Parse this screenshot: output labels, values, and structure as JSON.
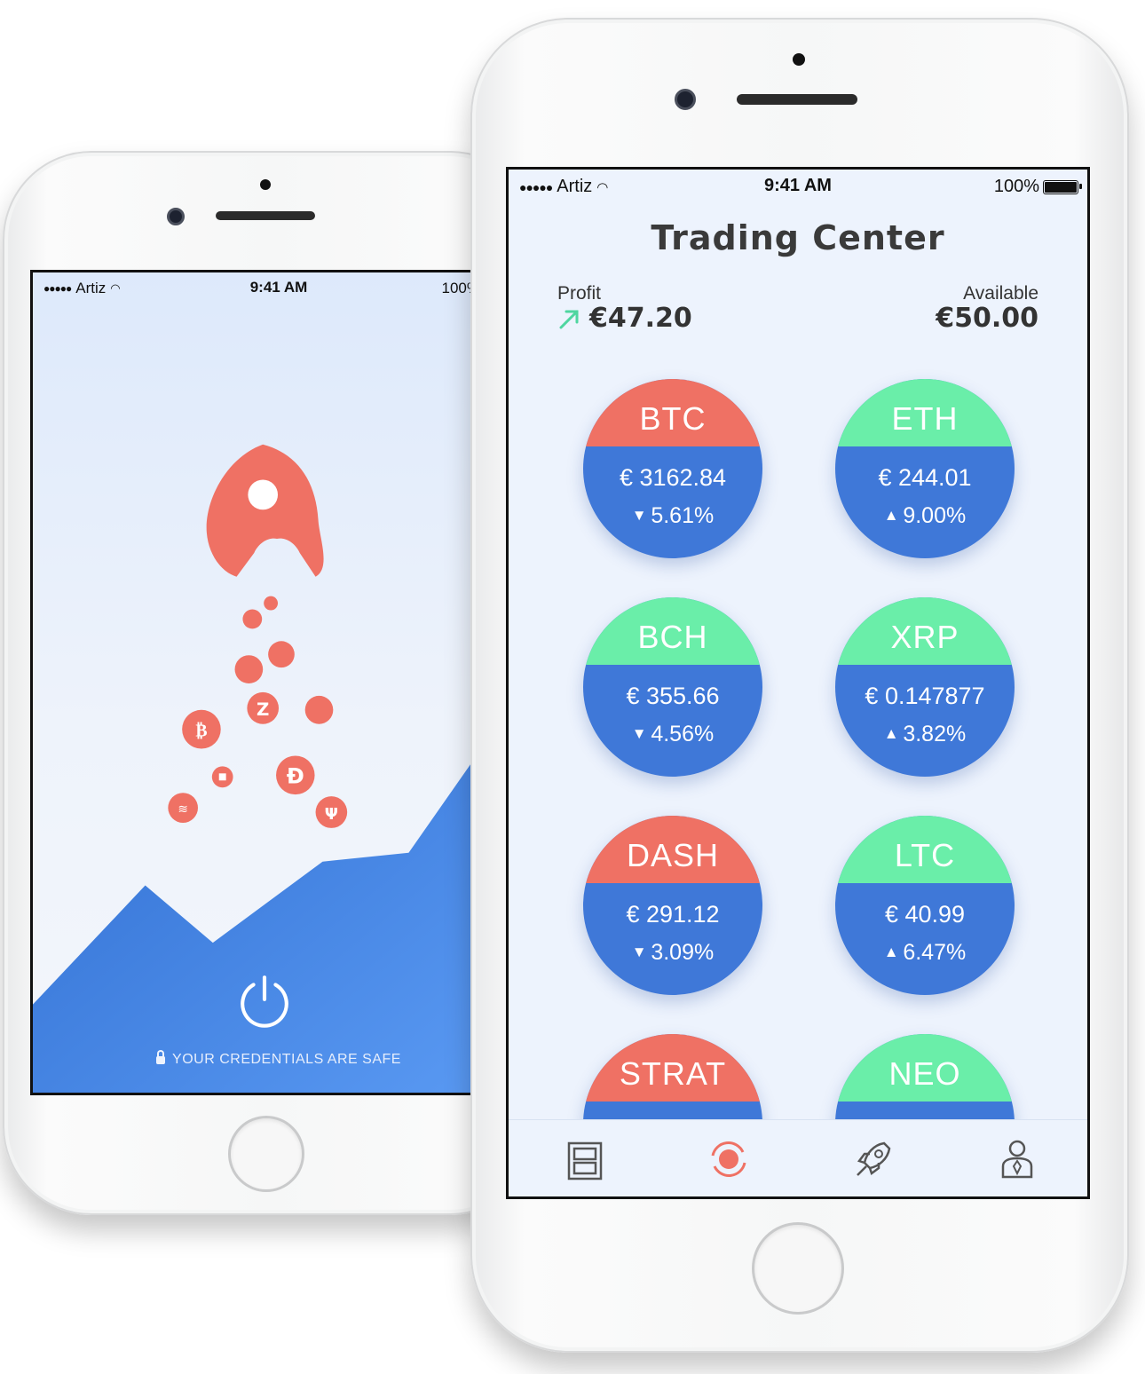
{
  "back_phone": {
    "status": {
      "carrier": "Artiz",
      "time": "9:41 AM",
      "battery": "100%"
    },
    "safe_message": "YOUR CREDENTIALS ARE SAFE",
    "icons": [
      "rocket-icon",
      "power-icon",
      "lock-icon"
    ]
  },
  "front_phone": {
    "status": {
      "carrier": "Artiz",
      "time": "9:41 AM",
      "battery": "100%"
    },
    "title": "Trading Center",
    "profit": {
      "label": "Profit",
      "value": "€47.20"
    },
    "available": {
      "label": "Available",
      "value": "€50.00"
    },
    "coins": [
      {
        "symbol": "BTC",
        "price": "€ 3162.84",
        "change": "5.61%",
        "direction": "down",
        "color": "#ef7164"
      },
      {
        "symbol": "ETH",
        "price": "€ 244.01",
        "change": "9.00%",
        "direction": "up",
        "color": "#6aeea9"
      },
      {
        "symbol": "BCH",
        "price": "€ 355.66",
        "change": "4.56%",
        "direction": "down",
        "color": "#6aeea9"
      },
      {
        "symbol": "XRP",
        "price": "€ 0.147877",
        "change": "3.82%",
        "direction": "up",
        "color": "#6aeea9"
      },
      {
        "symbol": "DASH",
        "price": "€ 291.12",
        "change": "3.09%",
        "direction": "down",
        "color": "#ef7164"
      },
      {
        "symbol": "LTC",
        "price": "€ 40.99",
        "change": "6.47%",
        "direction": "up",
        "color": "#6aeea9"
      },
      {
        "symbol": "STRAT",
        "color": "#ef7164"
      },
      {
        "symbol": "NEO",
        "color": "#6aeea9"
      }
    ],
    "tabs": [
      "dashboard-icon",
      "trade-icon",
      "rocket-icon",
      "profile-icon"
    ],
    "colors": {
      "accent": "#ef7164",
      "blue": "#3f78d8",
      "green": "#6aeea9",
      "up_arrow": "#4fd6a0"
    }
  }
}
